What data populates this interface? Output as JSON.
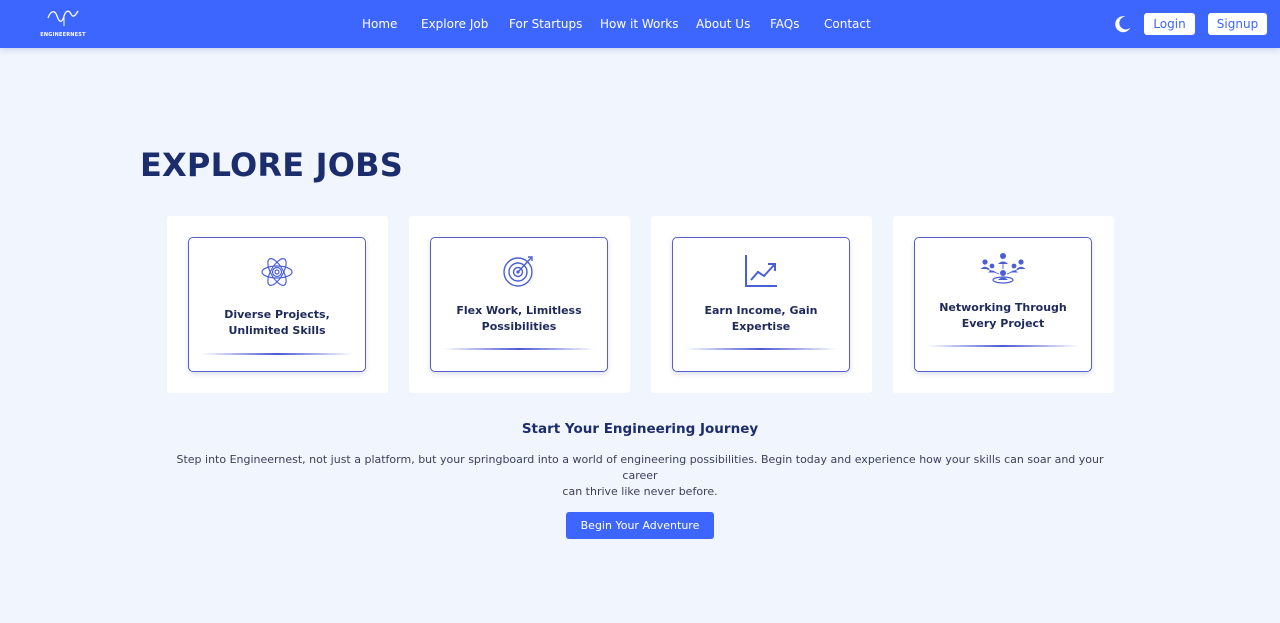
{
  "header": {
    "logo_text": "ENGINEERNEST",
    "nav": [
      "Home",
      "Explore Job",
      "For Startups",
      "How it Works",
      "About Us",
      "FAQs",
      "Contact"
    ],
    "theme_toggle_icon": "moon-icon",
    "login_label": "Login",
    "signup_label": "Signup"
  },
  "main": {
    "title": "EXPLORE JOBS",
    "cards": [
      {
        "icon": "atom-icon",
        "text_line1": "Diverse Projects,",
        "text_line2": "Unlimited Skills"
      },
      {
        "icon": "target-icon",
        "text_line1": "Flex Work, Limitless",
        "text_line2": "Possibilities"
      },
      {
        "icon": "growth-chart-icon",
        "text_line1": "Earn Income, Gain",
        "text_line2": "Expertise"
      },
      {
        "icon": "network-icon",
        "text_line1": "Networking Through",
        "text_line2": "Every Project"
      }
    ],
    "journey_heading": "Start Your Engineering Journey",
    "journey_text_line1": "Step into Engineernest, not just a platform, but your springboard into a world of engineering possibilities. Begin today and experience how your skills can soar and your career",
    "journey_text_line2": "can thrive like never before.",
    "cta_label": "Begin Your Adventure"
  },
  "colors": {
    "primary": "#3c66ff",
    "background": "#f1f5fe",
    "heading": "#1c2d6e",
    "card_border": "#5660c9"
  }
}
